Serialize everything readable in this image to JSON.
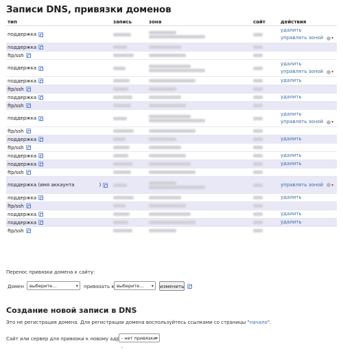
{
  "page_title": "Записи DNS, привязки доменов",
  "table": {
    "headers": [
      "тип",
      "запись",
      "зона",
      "сайт",
      "действия"
    ],
    "rows": [
      {
        "type": "поддержка",
        "size": "double",
        "hl": false,
        "actions": [
          "удалить",
          "управлять зоной"
        ]
      },
      {
        "type": "поддержка",
        "size": "single",
        "hl": true,
        "actions": []
      },
      {
        "type": "ftp/ssh",
        "size": "single",
        "hl": false,
        "actions": []
      },
      {
        "type": "поддержка",
        "size": "double",
        "hl": false,
        "actions": [
          "удалить",
          "управлять зоной"
        ]
      },
      {
        "type": "поддержка",
        "size": "single",
        "hl": false,
        "actions": [
          "удалить"
        ]
      },
      {
        "type": "ftp/ssh",
        "size": "single",
        "hl": true,
        "actions": []
      },
      {
        "type": "поддержка",
        "size": "single",
        "hl": false,
        "actions": [
          "удалить"
        ]
      },
      {
        "type": "ftp/ssh",
        "size": "single",
        "hl": true,
        "actions": []
      },
      {
        "type": "поддержка",
        "size": "double",
        "hl": false,
        "actions": [
          "удалить",
          "управлять зоной"
        ]
      },
      {
        "type": "ftp/ssh",
        "size": "single",
        "hl": false,
        "actions": []
      },
      {
        "type": "поддержка",
        "size": "single",
        "hl": true,
        "actions": [
          "удалить"
        ]
      },
      {
        "type": "ftp/ssh",
        "size": "single",
        "hl": false,
        "actions": []
      },
      {
        "type": "поддержка",
        "size": "single",
        "hl": false,
        "actions": [
          "удалить"
        ]
      },
      {
        "type": "поддержка",
        "size": "single",
        "hl": true,
        "actions": [
          "удалить"
        ]
      },
      {
        "type": "ftp/ssh",
        "size": "single",
        "hl": false,
        "actions": []
      },
      {
        "type": "поддержка (имя аккаунта",
        "type_suffix": ")",
        "size": "double",
        "hl": true,
        "actions": [
          "управлять зоной"
        ]
      },
      {
        "type": "поддержка",
        "size": "single",
        "hl": false,
        "actions": [
          "удалить"
        ]
      },
      {
        "type": "ftp/ssh",
        "size": "single",
        "hl": true,
        "actions": []
      },
      {
        "type": "поддержка",
        "size": "single",
        "hl": false,
        "actions": [
          "удалить"
        ]
      },
      {
        "type": "поддержка",
        "size": "single",
        "hl": true,
        "actions": [
          "удалить"
        ]
      },
      {
        "type": "ftp/ssh",
        "size": "single",
        "hl": false,
        "actions": []
      }
    ]
  },
  "transfer": {
    "heading": "Перенос привязки домена к сайту:",
    "domain_label": "Домен",
    "domain_select": "выберите...",
    "bind_label": "привязать к",
    "site_select": "выберите...",
    "change_button": "изменить"
  },
  "create": {
    "heading": "Создание новой записи в DNS",
    "note_before": "Это не регистрация домена. Для регистрации домена воспользуйтесь ссылками со страницы \"",
    "note_link": "начало",
    "note_after": "\".",
    "bind_label": "Сайт или сервер для привязки к новому адресу:",
    "bind_select": "- нет привязки -"
  }
}
